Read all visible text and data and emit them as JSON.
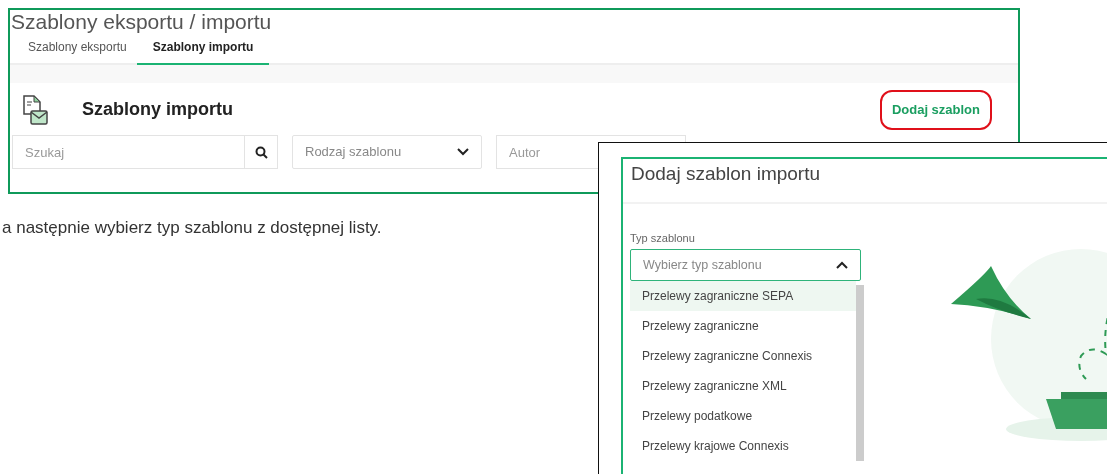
{
  "panel_main": {
    "page_title": "Szablony eksportu / importu",
    "tabs": [
      {
        "label": "Szablony eksportu",
        "selected": false
      },
      {
        "label": "Szablony importu",
        "selected": true
      }
    ],
    "section_title": "Szablony importu",
    "add_button": {
      "label": "Dodaj szablon",
      "highlighted": true
    },
    "filters": [
      {
        "kind": "search",
        "placeholder": "Szukaj"
      },
      {
        "kind": "select",
        "placeholder": "Rodzaj szablonu"
      },
      {
        "kind": "text",
        "placeholder": "Autor"
      }
    ]
  },
  "instruction": "a następnie wybierz typ szablonu z dostępnej listy.",
  "dialog": {
    "title": "Dodaj szablon importu",
    "field_label": "Typ szablonu",
    "select": {
      "placeholder": "Wybierz typ szablonu",
      "expanded": true
    },
    "options": [
      {
        "label": "Przelewy zagraniczne SEPA",
        "selected": true
      },
      {
        "label": "Przelewy zagraniczne",
        "selected": false
      },
      {
        "label": "Przelewy zagraniczne Connexis",
        "selected": false
      },
      {
        "label": "Przelewy zagraniczne XML",
        "selected": false
      },
      {
        "label": "Przelewy podatkowe",
        "selected": false
      },
      {
        "label": "Przelewy krajowe Connexis",
        "selected": false
      }
    ]
  }
}
